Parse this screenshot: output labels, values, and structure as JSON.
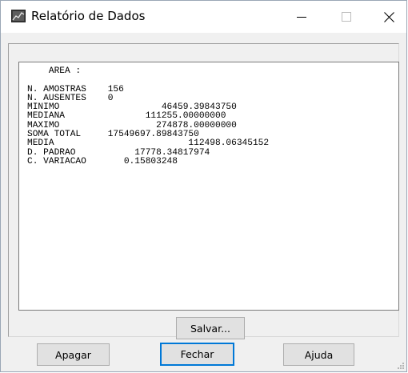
{
  "window": {
    "title": "Relatório de Dados",
    "controls": {
      "minimize": "—",
      "maximize": "☐",
      "close": "✕"
    }
  },
  "report": {
    "lines": [
      "    AREA :",
      "",
      "N. AMOSTRAS    156",
      "N. AUSENTES    0",
      "MINIMO                   46459.39843750",
      "MEDIANA               111255.00000000",
      "MAXIMO                  274878.00000000",
      "SOMA TOTAL     17549697.89843750",
      "MEDIA                         112498.06345152",
      "D. PADRAO           17778.34817974",
      "C. VARIACAO       0.15803248"
    ]
  },
  "buttons": {
    "save": "Salvar...",
    "clear": "Apagar",
    "close": "Fechar",
    "help": "Ajuda"
  },
  "icons": {
    "app": "chart-window-icon",
    "minimize": "minimize-icon",
    "maximize": "maximize-icon",
    "close": "close-icon",
    "grip": "resize-grip-icon"
  }
}
